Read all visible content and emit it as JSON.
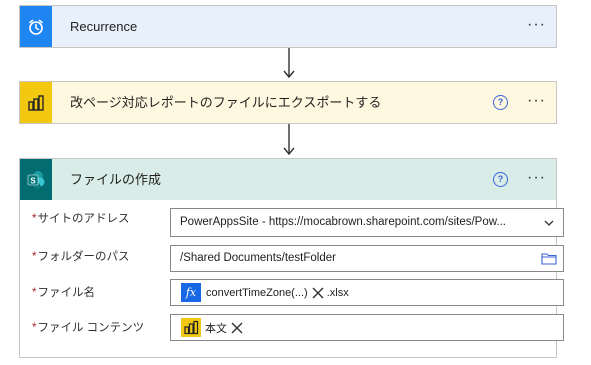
{
  "steps": [
    {
      "title": "Recurrence",
      "icon": "alarm-clock-icon",
      "more_label": "···",
      "colors": {
        "header_bg": "#e8f0fb",
        "icon_bg": "#1f85f1"
      }
    },
    {
      "title": "改ページ対応レポートのファイルにエクスポートする",
      "icon": "power-bi-icon",
      "help_label": "?",
      "more_label": "···",
      "colors": {
        "header_bg": "#fef8e1",
        "icon_bg": "#f2c811"
      }
    },
    {
      "title": "ファイルの作成",
      "icon": "sharepoint-icon",
      "help_label": "?",
      "more_label": "···",
      "colors": {
        "header_bg": "#d9ece8",
        "icon_bg": "#036c70"
      }
    }
  ],
  "create_file": {
    "fields": [
      {
        "label": "サイトのアドレス",
        "required_mark": "*",
        "value": "PowerAppsSite - https://mocabrown.sharepoint.com/sites/Pow...",
        "icon": "chevron-down-icon"
      },
      {
        "label": "フォルダーのパス",
        "required_mark": "*",
        "value": "/Shared Documents/testFolder",
        "icon": "folder-icon"
      },
      {
        "label": "ファイル名",
        "required_mark": "*",
        "token_label": "convertTimeZone(...)",
        "token_icon": "fx-icon",
        "suffix": ".xlsx"
      },
      {
        "label": "ファイル コンテンツ",
        "required_mark": "*",
        "token_label": "本文",
        "token_icon": "power-bi-icon"
      }
    ]
  },
  "colors": {
    "accent": "#3b66d6",
    "fx_token_bg": "#1868e6",
    "required": "#a4262c",
    "connector": "#323130"
  }
}
